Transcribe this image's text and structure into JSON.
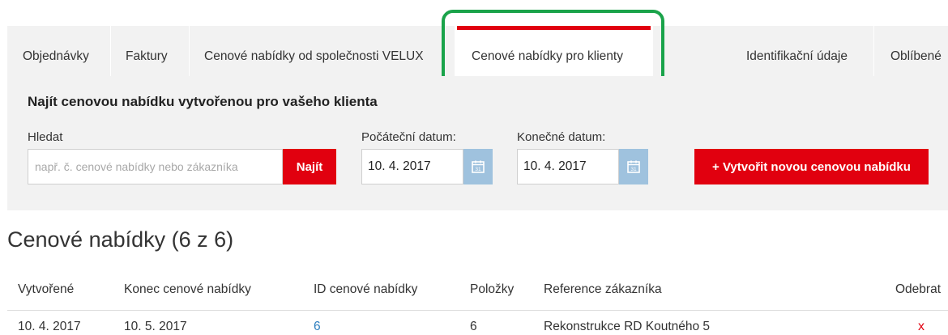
{
  "tabs": [
    {
      "label": "Objednávky"
    },
    {
      "label": "Faktury"
    },
    {
      "label": "Cenové nabídky od společnosti VELUX"
    },
    {
      "label": "Cenové nabídky pro klienty",
      "active": true
    },
    {
      "label": "Identifikační údaje"
    },
    {
      "label": "Oblíbené"
    }
  ],
  "search": {
    "title": "Najít cenovou nabídku vytvořenou pro vašeho klienta",
    "search_label": "Hledat",
    "placeholder": "např. č. cenové nabídky nebo zákazníka",
    "find_button": "Najít",
    "start_label": "Počáteční datum:",
    "start_value": "10. 4. 2017",
    "end_label": "Konečné datum:",
    "end_value": "10. 4. 2017",
    "create_button": "+ Vytvořit novou cenovou nabídku"
  },
  "quotes": {
    "heading": "Cenové nabídky (6 z 6)",
    "columns": [
      "Vytvořené",
      "Konec cenové nabídky",
      "ID cenové nabídky",
      "Položky",
      "Reference zákazníka",
      "Odebrat"
    ],
    "rows": [
      {
        "created": "10. 4. 2017",
        "expires": "10. 5. 2017",
        "id": "6",
        "items": "6",
        "reference": "Rekonstrukce RD Koutného 5",
        "remove": "x"
      }
    ]
  },
  "colors": {
    "accent_red": "#e1000f",
    "highlight_green": "#1aa34a",
    "link_blue": "#2e7fbf",
    "calendar_blue": "#9fc2de",
    "panel_gray": "#f2f2f2"
  },
  "icons": {
    "calendar": "calendar-icon"
  }
}
